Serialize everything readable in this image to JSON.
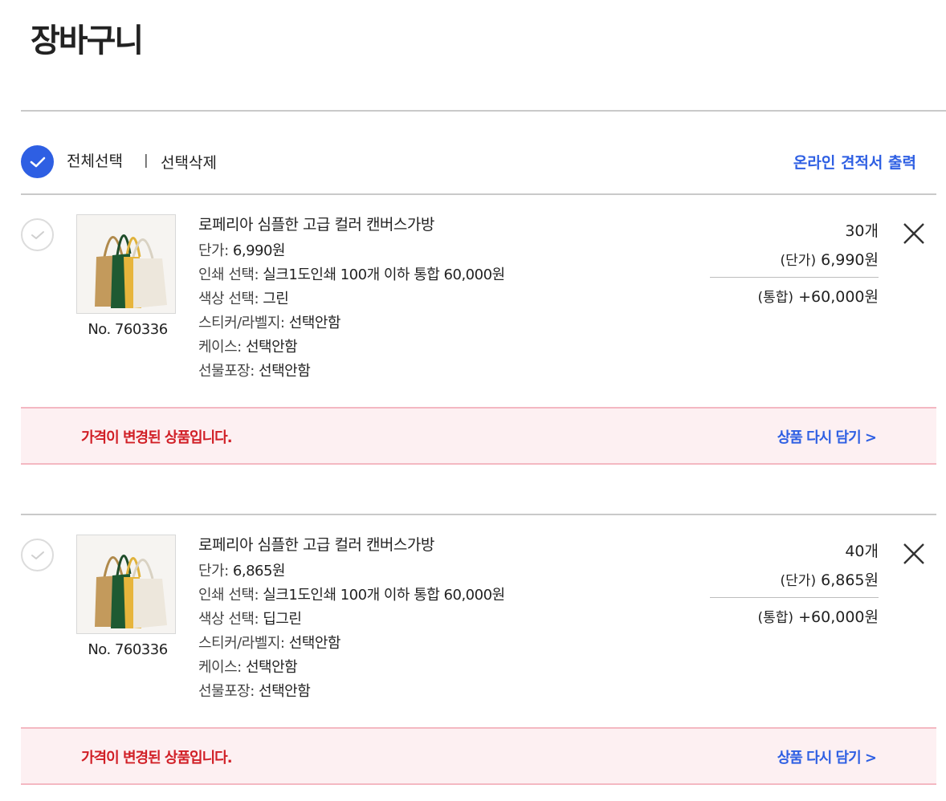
{
  "page": {
    "title": "장바구니"
  },
  "select_bar": {
    "select_all_label": "전체선택",
    "divider": "|",
    "delete_selected_label": "선택삭제",
    "print_quote_label": "온라인 견적서 출력"
  },
  "colors": {
    "accent": "#2e5fe3",
    "warning_text": "#d11f26",
    "warning_bg": "#fdf0f2",
    "warning_border": "#f4b8c2"
  },
  "items": [
    {
      "name": "로페리아 심플한 고급 컬러 캔버스가방",
      "product_no": "No. 760336",
      "options": [
        {
          "label": "단가: ",
          "value": "6,990원"
        },
        {
          "label": "인쇄 선택: ",
          "value": "실크1도인쇄 100개 이하 통합 60,000원"
        },
        {
          "label": "색상 선택: ",
          "value": "그린"
        },
        {
          "label": "스티커/라벨지: ",
          "value": "선택안함"
        },
        {
          "label": "케이스: ",
          "value": "선택안함"
        },
        {
          "label": "선물포장: ",
          "value": "선택안함"
        }
      ],
      "quantity": "30개",
      "unit_tag": "(단가)",
      "unit_price": "6,990원",
      "bundle_tag": "(통합)",
      "bundle_price": "+60,000원",
      "notice": "가격이 변경된 상품입니다.",
      "recart_label": "상품 다시 담기 >",
      "checked": false
    },
    {
      "name": "로페리아 심플한 고급 컬러 캔버스가방",
      "product_no": "No. 760336",
      "options": [
        {
          "label": "단가: ",
          "value": "6,865원"
        },
        {
          "label": "인쇄 선택: ",
          "value": "실크1도인쇄 100개 이하 통합 60,000원"
        },
        {
          "label": "색상 선택: ",
          "value": "딥그린"
        },
        {
          "label": "스티커/라벨지: ",
          "value": "선택안함"
        },
        {
          "label": "케이스: ",
          "value": "선택안함"
        },
        {
          "label": "선물포장: ",
          "value": "선택안함"
        }
      ],
      "quantity": "40개",
      "unit_tag": "(단가)",
      "unit_price": "6,865원",
      "bundle_tag": "(통합)",
      "bundle_price": "+60,000원",
      "notice": "가격이 변경된 상품입니다.",
      "recart_label": "상품 다시 담기 >",
      "checked": false
    }
  ]
}
